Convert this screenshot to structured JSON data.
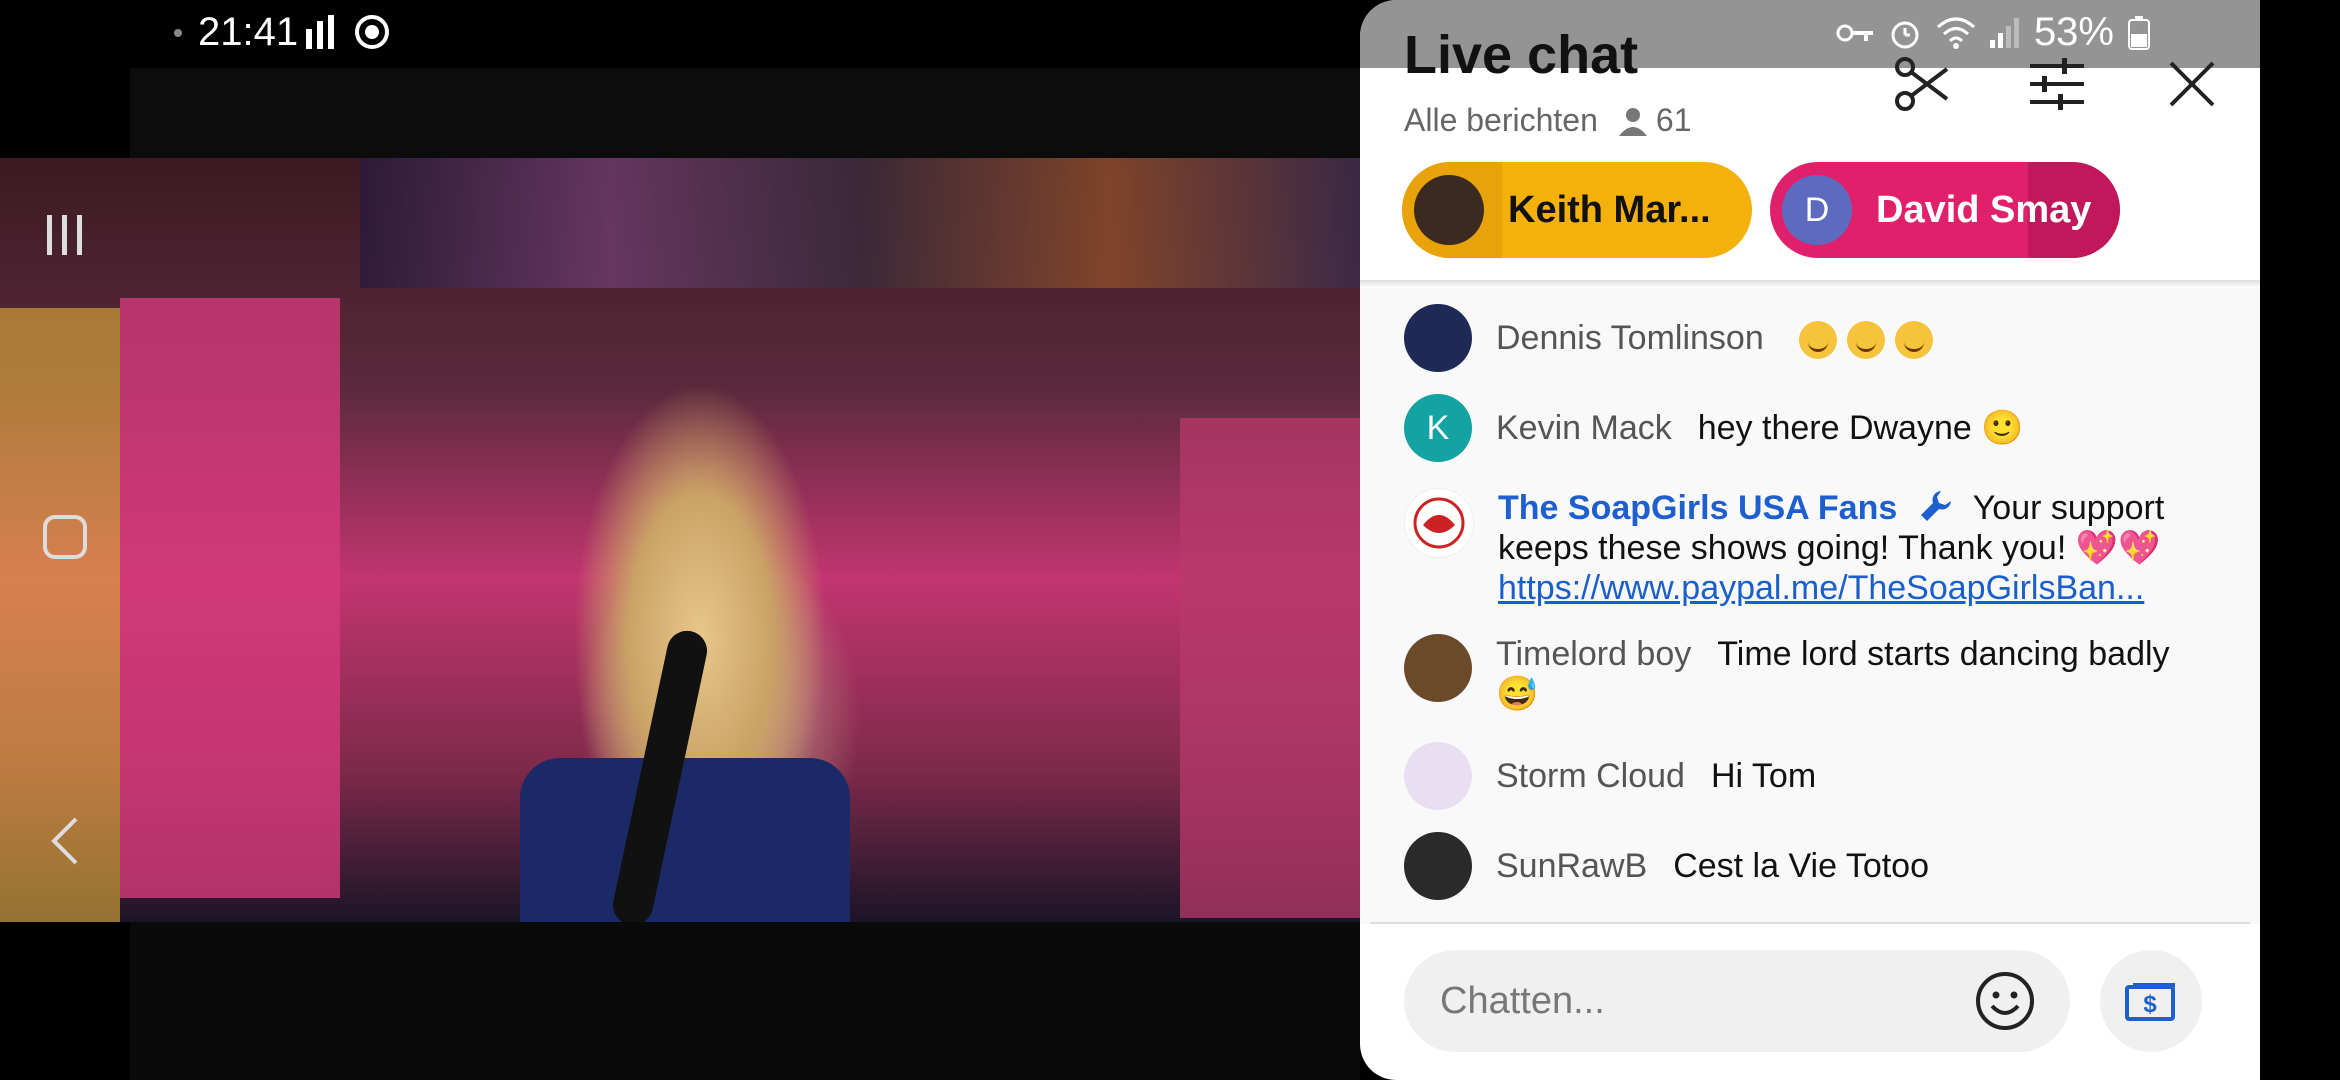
{
  "status_bar": {
    "time": "21:41",
    "battery": "53%"
  },
  "nav": {
    "recents_icon": "recents-icon",
    "home_icon": "home-icon",
    "back_icon": "back-icon"
  },
  "chat": {
    "title": "Live chat",
    "filter_label": "Alle berichten",
    "viewer_count": "61",
    "pinned": [
      {
        "name": "Keith Mar...",
        "initial": "",
        "color": "#f4b10b"
      },
      {
        "name": "David Smay",
        "initial": "D",
        "color": "#e0206a"
      }
    ],
    "messages": [
      {
        "author": "Dennis Tomlinson",
        "text": "",
        "initial": "",
        "avatar_color": "#1d2a55"
      },
      {
        "author": "Kevin Mack",
        "text": "hey there Dwayne 🙂",
        "initial": "K",
        "avatar_color": "#13a3a3"
      },
      {
        "author": "The SoapGirls USA Fans",
        "text": "Your support keeps these shows going! Thank you! 💖💖",
        "link": "https://www.paypal.me/TheSoapGirlsBan...",
        "initial": "",
        "avatar_color": "#ffffff"
      },
      {
        "author": "Timelord boy",
        "text": "Time lord starts dancing badly 😅",
        "initial": "",
        "avatar_color": "#6b4a2a"
      },
      {
        "author": "Storm Cloud",
        "text": "Hi Tom",
        "initial": "",
        "avatar_color": "#e8e0f0"
      },
      {
        "author": "SunRawB",
        "text": "Cest la Vie Totoo",
        "initial": "",
        "avatar_color": "#2a2a2a"
      }
    ],
    "input_placeholder": "Chatten..."
  }
}
